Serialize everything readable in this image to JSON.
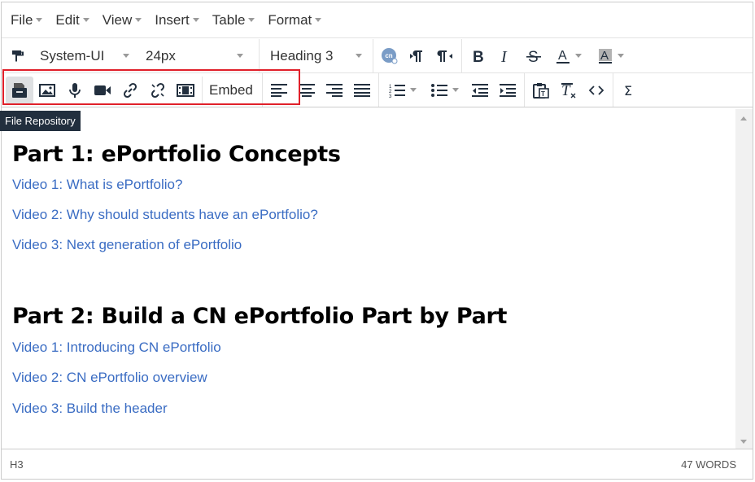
{
  "menubar": {
    "items": [
      {
        "label": "File"
      },
      {
        "label": "Edit"
      },
      {
        "label": "View"
      },
      {
        "label": "Insert"
      },
      {
        "label": "Table"
      },
      {
        "label": "Format"
      }
    ]
  },
  "toolbar": {
    "font_family": "System-UI",
    "font_size": "24px",
    "block_format": "Heading 3",
    "embed_label": "Embed",
    "tooltip": "File Repository",
    "highlight_color": "#e0202a"
  },
  "content": {
    "sections": [
      {
        "heading": "Part 1: ePortfolio Concepts",
        "links": [
          "Video 1: What is ePortfolio?",
          "Video 2: Why should students have an ePortfolio?",
          "Video 3: Next generation of ePortfolio"
        ]
      },
      {
        "heading": "Part 2: Build a CN ePortfolio Part by Part",
        "links": [
          "Video 1: Introducing CN ePortfolio",
          "Video 2: CN ePortfolio overview",
          "Video 3: Build the header"
        ]
      }
    ],
    "link_color": "#3a6cc3"
  },
  "statusbar": {
    "path": "H3",
    "word_count": "47 WORDS"
  }
}
